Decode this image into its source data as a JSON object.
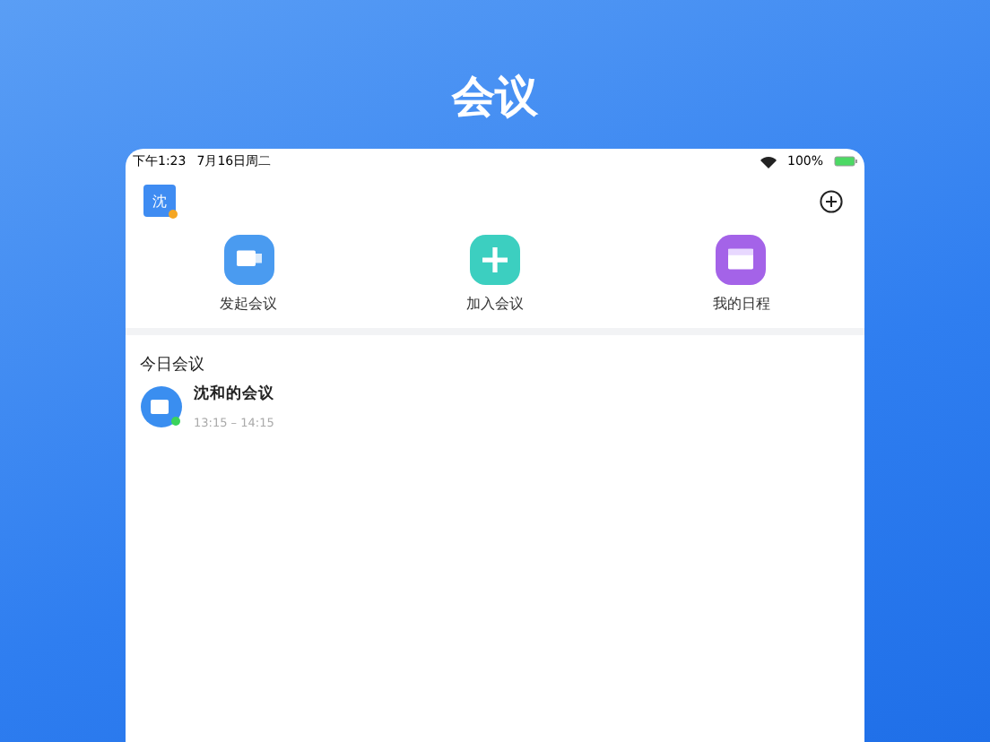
{
  "page_title": "会议",
  "status_bar": {
    "time": "下午1:23",
    "date": "7月16日周二",
    "battery": "100%"
  },
  "header": {
    "avatar": "沈"
  },
  "actions": [
    {
      "label": "发起会议",
      "kind": "video",
      "color": "#4a9bf0"
    },
    {
      "label": "加入会议",
      "kind": "join",
      "color": "#3ccfc0"
    },
    {
      "label": "我的日程",
      "kind": "calendar",
      "color": "#a463e8"
    }
  ],
  "section_title": "今日会议",
  "meetings": [
    {
      "title": "沈和的会议",
      "time": "13:15 – 14:15"
    }
  ]
}
